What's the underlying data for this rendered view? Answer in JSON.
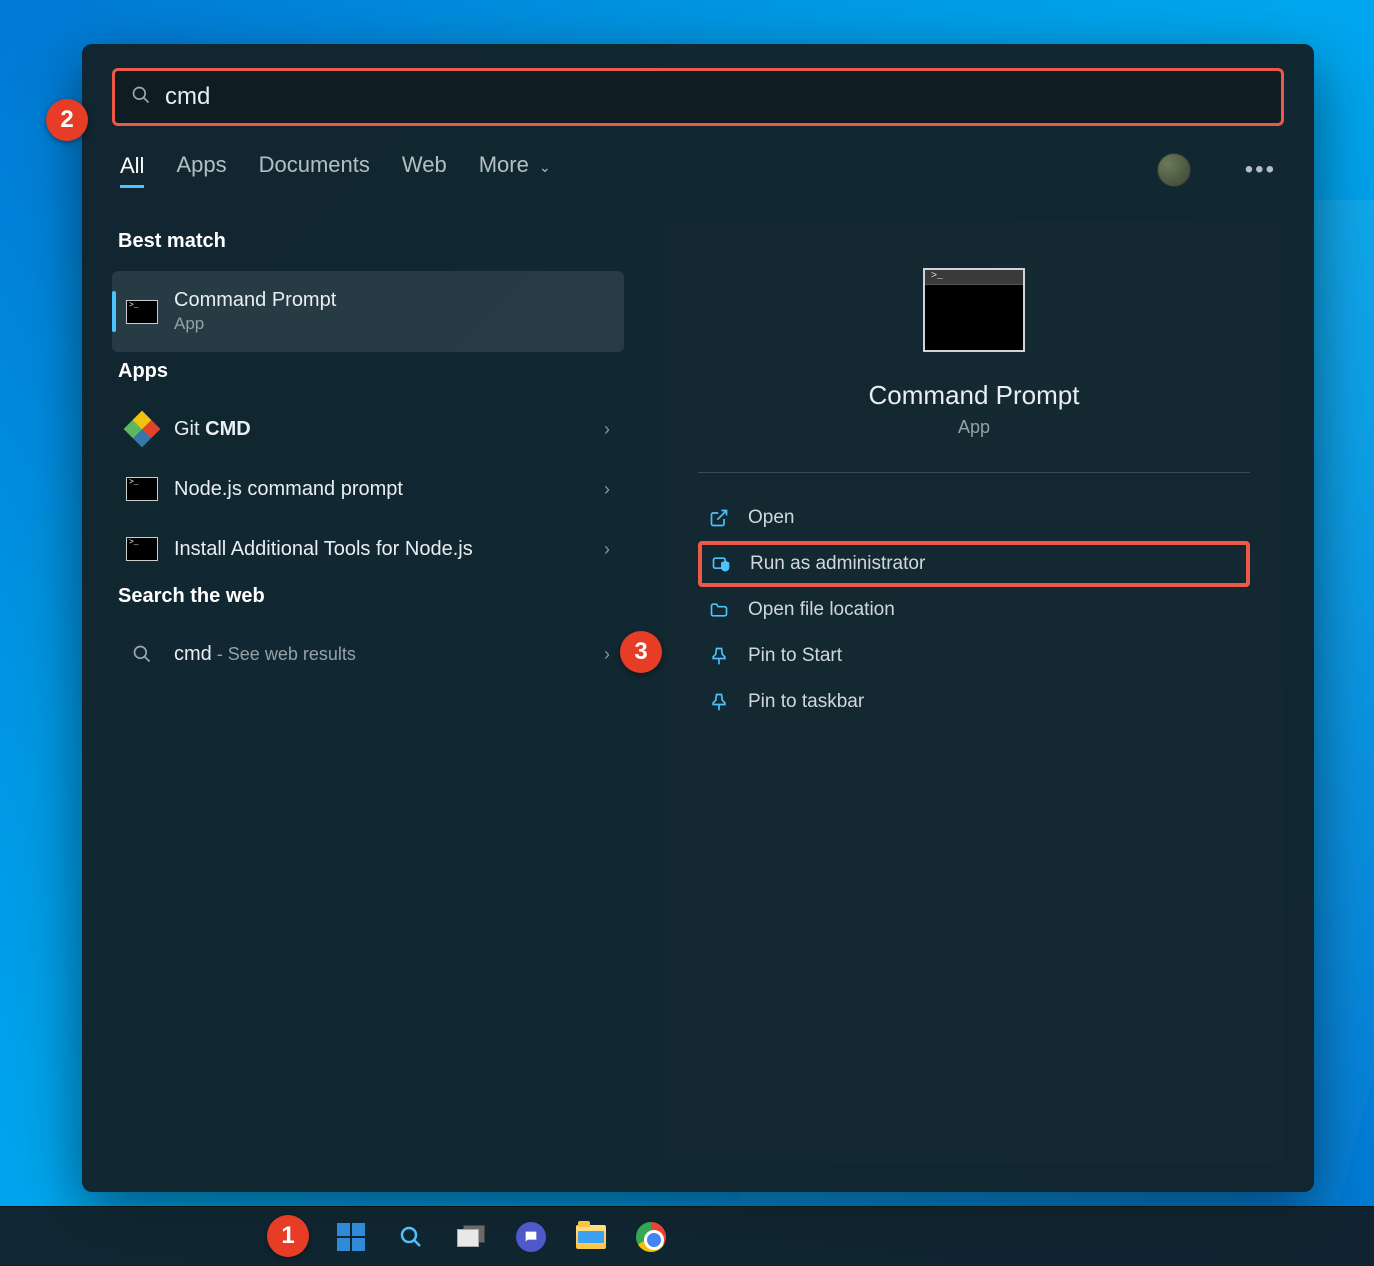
{
  "search": {
    "value": "cmd"
  },
  "tabs": {
    "items": [
      "All",
      "Apps",
      "Documents",
      "Web",
      "More"
    ],
    "active": 0
  },
  "sections": {
    "best_match": "Best match",
    "apps": "Apps",
    "search_web": "Search the web"
  },
  "results": {
    "best": {
      "title": "Command Prompt",
      "sub": "App"
    },
    "apps": [
      {
        "title_pre": "Git ",
        "title_bold": "CMD",
        "title_post": ""
      },
      {
        "title_pre": "Node.js command prompt",
        "title_bold": "",
        "title_post": ""
      },
      {
        "title_pre": "Install Additional Tools for Node.js",
        "title_bold": "",
        "title_post": ""
      }
    ],
    "web": {
      "query": "cmd",
      "suffix": " - See web results"
    }
  },
  "preview": {
    "title": "Command Prompt",
    "sub": "App",
    "actions": [
      {
        "label": "Open",
        "icon": "open-external"
      },
      {
        "label": "Run as administrator",
        "icon": "admin-shield"
      },
      {
        "label": "Open file location",
        "icon": "folder"
      },
      {
        "label": "Pin to Start",
        "icon": "pin"
      },
      {
        "label": "Pin to taskbar",
        "icon": "pin"
      }
    ]
  },
  "annotations": {
    "1": "1",
    "2": "2",
    "3": "3"
  }
}
